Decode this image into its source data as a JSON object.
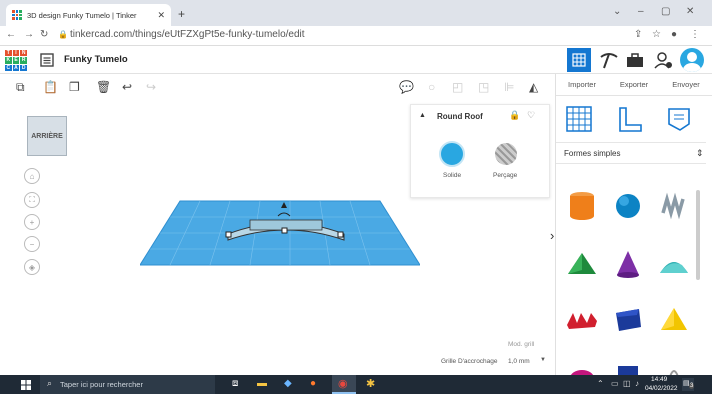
{
  "browser": {
    "tab_title": "3D design Funky Tumelo | Tinker",
    "url": "tinkercad.com/things/eUtFZXgPt5e-funky-tumelo/edit"
  },
  "app": {
    "project_name": "Funky Tumelo"
  },
  "viewcube": {
    "label": "ARRIÈRE"
  },
  "inspector": {
    "title": "Round Roof",
    "solid_label": "Solide",
    "hole_label": "Perçage"
  },
  "canvas": {
    "grid_edit_label": "Mod. grill",
    "snap_label": "Grille D'accrochage",
    "snap_value": "1,0 mm"
  },
  "right_panel": {
    "tabs": [
      "Importer",
      "Exporter",
      "Envoyer"
    ],
    "category": "Formes simples"
  },
  "taskbar": {
    "search_placeholder": "Taper ici pour rechercher",
    "time": "14:49",
    "date": "04/02/2022",
    "notif_count": "3"
  },
  "colors": {
    "grid": "#4aa9e4",
    "accent": "#29a7e1",
    "brand_red": "#e4522d",
    "brand_green": "#28ae5f",
    "brand_blue": "#1477d1"
  }
}
